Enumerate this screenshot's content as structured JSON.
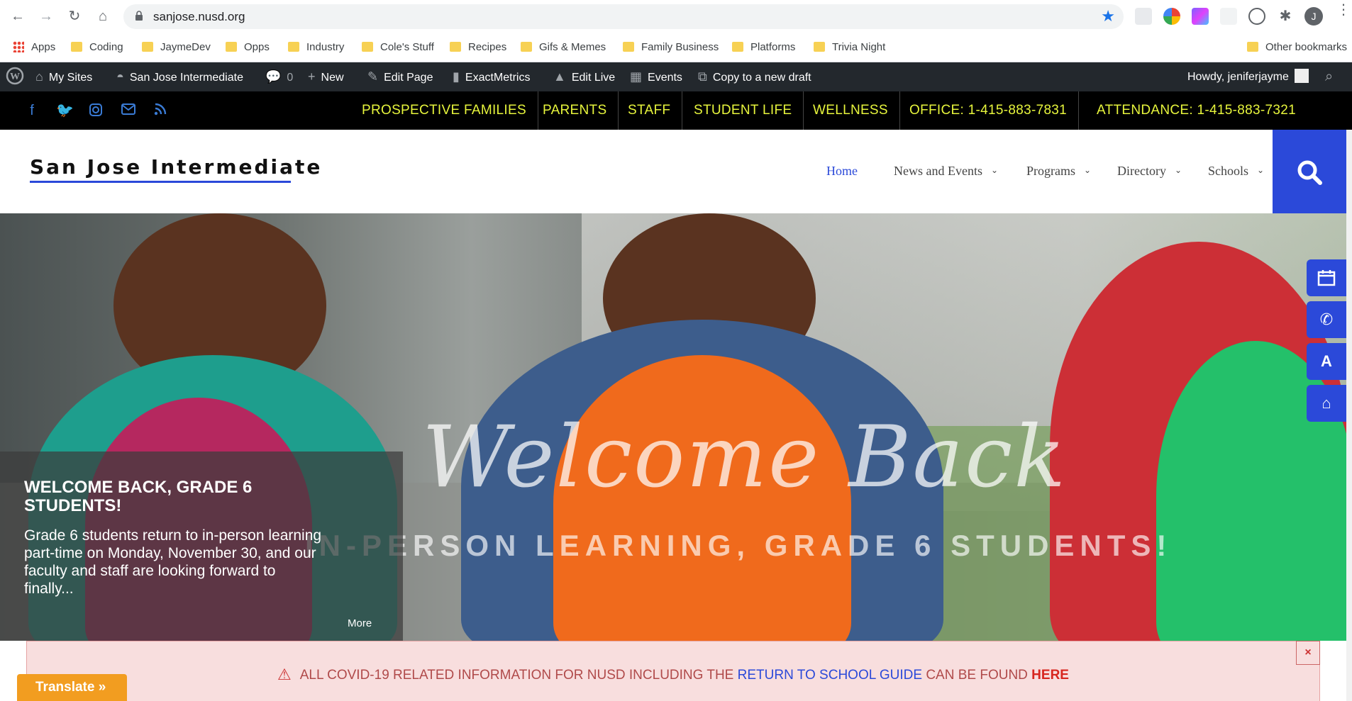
{
  "browser": {
    "url": "sanjose.nusd.org",
    "profile_initial": "J"
  },
  "bookmarks": [
    {
      "label": "Apps"
    },
    {
      "label": "Coding"
    },
    {
      "label": "JaymeDev"
    },
    {
      "label": "Opps"
    },
    {
      "label": "Industry"
    },
    {
      "label": "Cole's Stuff"
    },
    {
      "label": "Recipes"
    },
    {
      "label": "Gifs & Memes"
    },
    {
      "label": "Family Business"
    },
    {
      "label": "Platforms"
    },
    {
      "label": "Trivia Night"
    },
    {
      "label": "Other bookmarks"
    }
  ],
  "wpbar": {
    "my_sites": "My Sites",
    "site_name": "San Jose Intermediate",
    "comments_count": "0",
    "new": "New",
    "edit_page": "Edit Page",
    "exactmetrics": "ExactMetrics",
    "edit_live": "Edit Live",
    "events": "Events",
    "copy_draft": "Copy to a new draft",
    "howdy": "Howdy, jeniferjayme"
  },
  "topnav": {
    "items": [
      {
        "label": "PROSPECTIVE FAMILIES"
      },
      {
        "label": "PARENTS"
      },
      {
        "label": "STAFF"
      },
      {
        "label": "STUDENT LIFE"
      },
      {
        "label": "WELLNESS"
      },
      {
        "label": "OFFICE: 1-415-883-7831"
      },
      {
        "label": "ATTENDANCE: 1-415-883-7321"
      }
    ]
  },
  "site": {
    "logo": "San Jose Intermediate",
    "nav": [
      {
        "label": "Home"
      },
      {
        "label": "News and Events"
      },
      {
        "label": "Programs"
      },
      {
        "label": "Directory"
      },
      {
        "label": "Schools"
      }
    ]
  },
  "hero": {
    "script_title": "Welcome Back",
    "subtitle": "IN-PERSON LEARNING, GRADE 6 STUDENTS!",
    "caption_title": "WELCOME BACK, GRADE 6 STUDENTS!",
    "caption_text": "Grade 6 students return to in-person learning part-time on Monday, November 30, and our faculty and staff are looking forward to finally...",
    "more": "More"
  },
  "side_tabs": {
    "accessibility_label": "A"
  },
  "covid": {
    "text_before": "ALL COVID-19 RELATED INFORMATION FOR NUSD INCLUDING THE ",
    "link_text": "RETURN TO SCHOOL GUIDE",
    "text_middle": " CAN BE FOUND ",
    "here": "HERE",
    "close": "×"
  },
  "translate": {
    "label": "Translate »"
  },
  "colors": {
    "accent_blue": "#2b49d9",
    "topnav_yellow": "#e7f53c",
    "wp_bar": "#23282d",
    "translate_orange": "#f29d20"
  }
}
